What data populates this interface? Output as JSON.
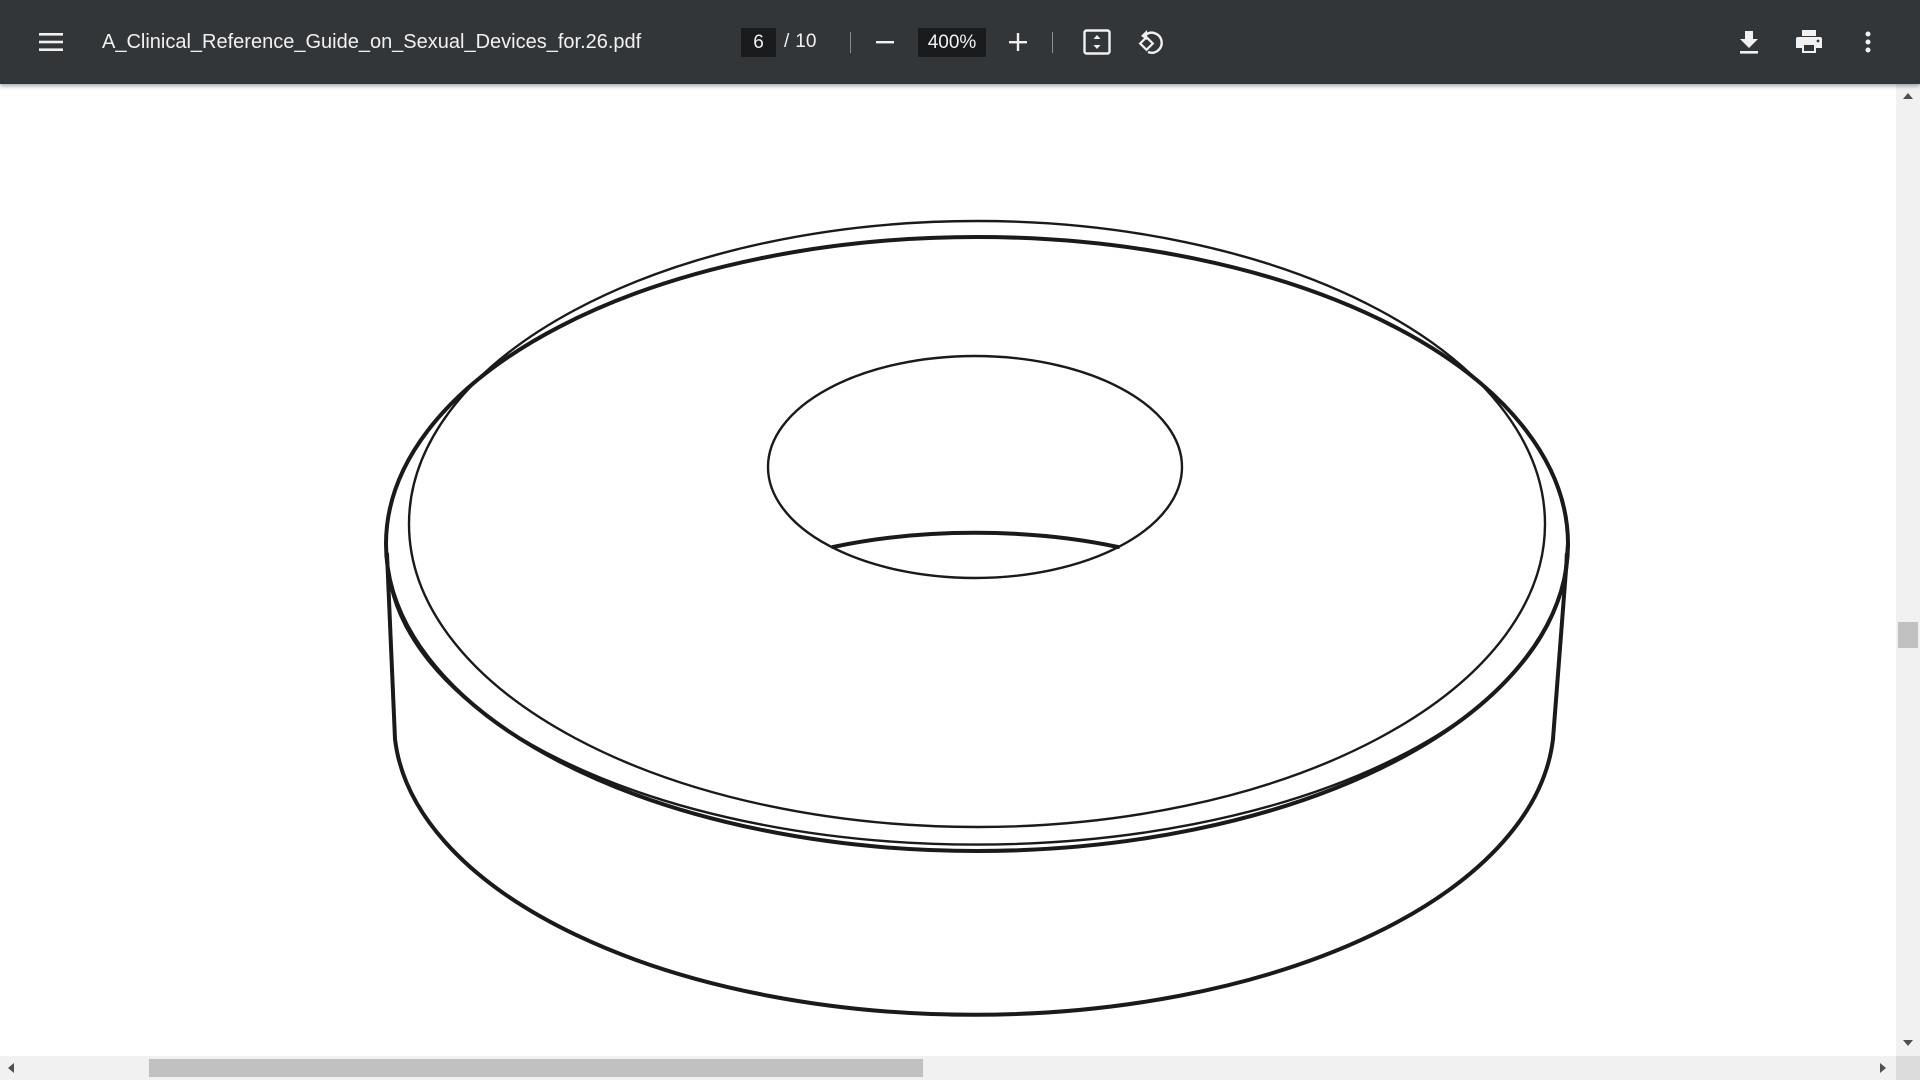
{
  "toolbar": {
    "menu_icon": "hamburger-menu-icon",
    "file_name": "A_Clinical_Reference_Guide_on_Sexual_Devices_for.26.pdf",
    "current_page": "6",
    "page_separator": "/",
    "total_pages": "10",
    "zoom_out_icon": "minus-icon",
    "zoom_level": "400%",
    "zoom_in_icon": "plus-icon",
    "fit_page_icon": "fit-to-page-icon",
    "rotate_icon": "rotate-counterclockwise-icon",
    "download_icon": "download-icon",
    "print_icon": "print-icon",
    "more_icon": "more-vertical-icon",
    "background_color": "#323639",
    "text_color": "#f1f1f1"
  },
  "document": {
    "illustration": "ring-line-drawing",
    "background_color": "#ffffff",
    "line_color": "#1a1a1a"
  },
  "scrollbars": {
    "vertical_position": 0.5,
    "horizontal_position": 0.1,
    "horizontal_visible_fraction": 0.41
  }
}
